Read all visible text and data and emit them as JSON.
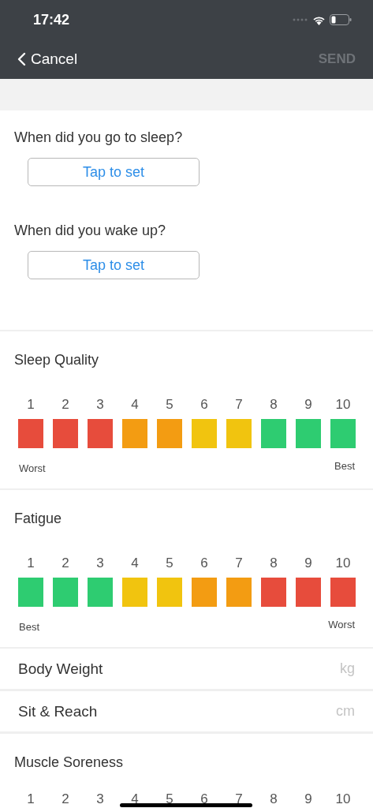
{
  "status_bar": {
    "time": "17:42"
  },
  "nav": {
    "back": "Cancel",
    "action": "SEND",
    "action_disabled": true
  },
  "questions": [
    {
      "label": "When did you go to sleep?",
      "button": "Tap to set"
    },
    {
      "label": "When did you wake up?",
      "button": "Tap to set"
    }
  ],
  "scales_top": [
    {
      "title": "Sleep Quality",
      "low_label": "Worst",
      "high_label": "Best",
      "options": [
        {
          "number": "1",
          "color": "#e74c3c"
        },
        {
          "number": "2",
          "color": "#e74c3c"
        },
        {
          "number": "3",
          "color": "#e74c3c"
        },
        {
          "number": "4",
          "color": "#f39c12"
        },
        {
          "number": "5",
          "color": "#f39c12"
        },
        {
          "number": "6",
          "color": "#f1c40f"
        },
        {
          "number": "7",
          "color": "#f1c40f"
        },
        {
          "number": "8",
          "color": "#2ecc71"
        },
        {
          "number": "9",
          "color": "#2ecc71"
        },
        {
          "number": "10",
          "color": "#2ecc71"
        }
      ]
    },
    {
      "title": "Fatigue",
      "low_label": "Best",
      "high_label": "Worst",
      "options": [
        {
          "number": "1",
          "color": "#2ecc71"
        },
        {
          "number": "2",
          "color": "#2ecc71"
        },
        {
          "number": "3",
          "color": "#2ecc71"
        },
        {
          "number": "4",
          "color": "#f1c40f"
        },
        {
          "number": "5",
          "color": "#f1c40f"
        },
        {
          "number": "6",
          "color": "#f39c12"
        },
        {
          "number": "7",
          "color": "#f39c12"
        },
        {
          "number": "8",
          "color": "#e74c3c"
        },
        {
          "number": "9",
          "color": "#e74c3c"
        },
        {
          "number": "10",
          "color": "#e74c3c"
        }
      ]
    }
  ],
  "measurements": [
    {
      "label": "Body Weight",
      "unit": "kg"
    },
    {
      "label": "Sit & Reach",
      "unit": "cm"
    }
  ],
  "scale_bottom": {
    "title": "Muscle Soreness",
    "numbers": [
      "1",
      "2",
      "3",
      "4",
      "5",
      "6",
      "7",
      "8",
      "9",
      "10"
    ]
  }
}
